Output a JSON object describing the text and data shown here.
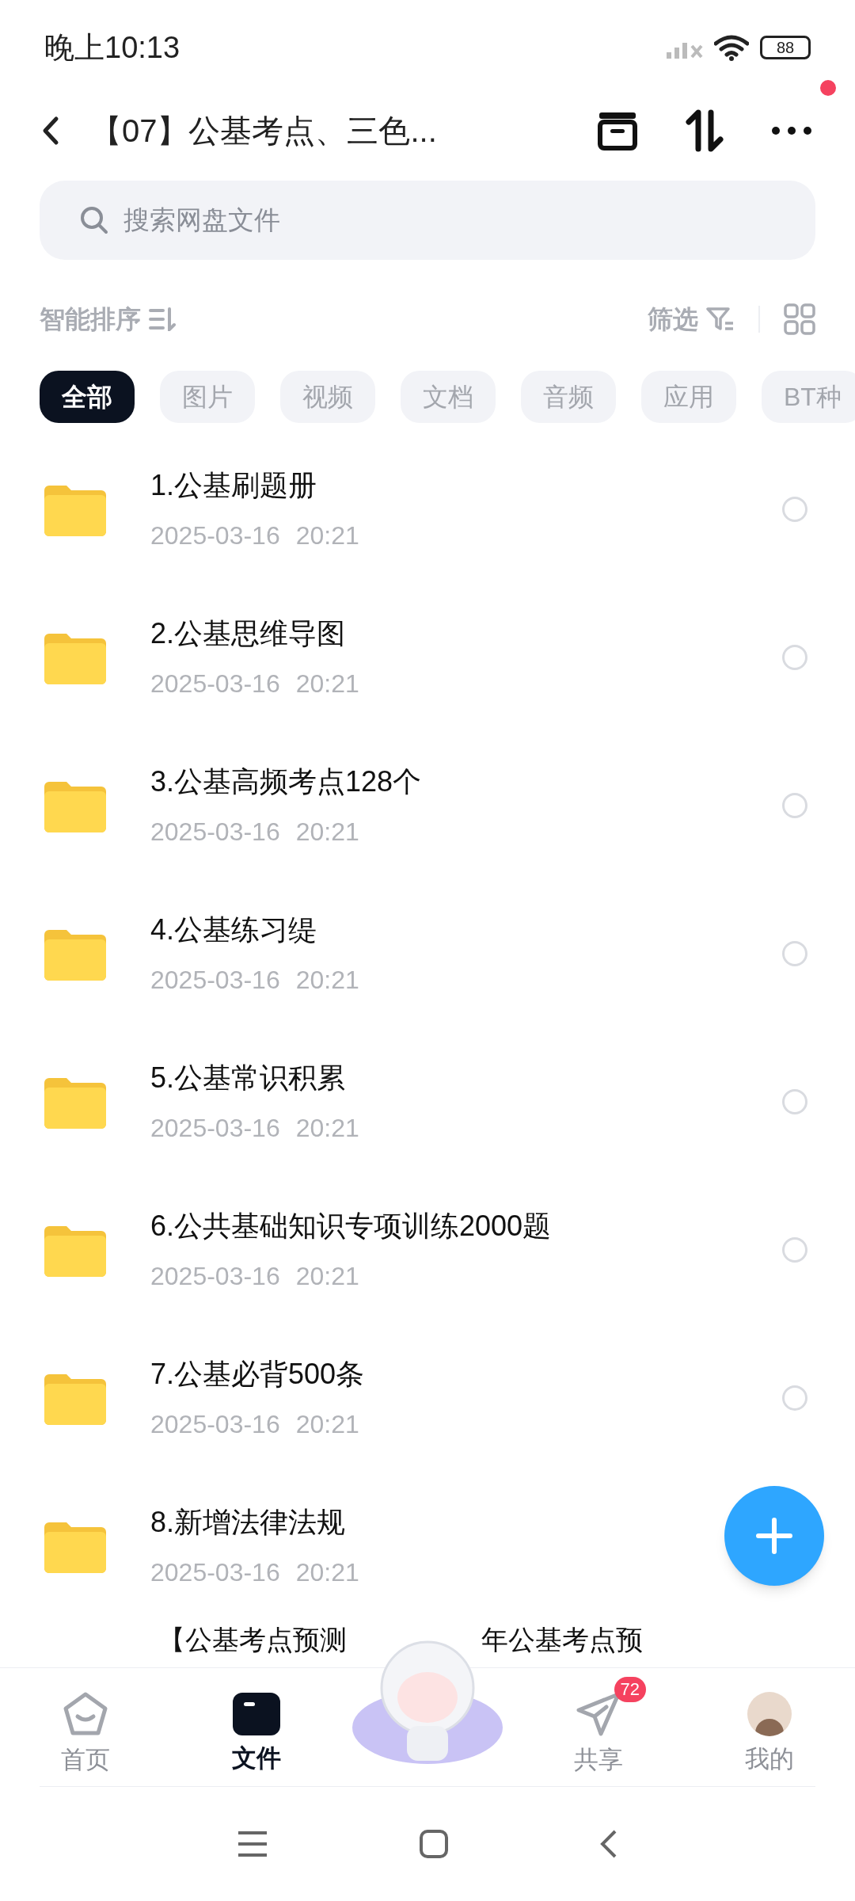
{
  "status_bar": {
    "time": "晚上10:13",
    "battery": "88"
  },
  "header": {
    "title": "【07】公基考点、三色...",
    "notification_dot": true
  },
  "search": {
    "placeholder": "搜索网盘文件"
  },
  "toolbar": {
    "sort": "智能排序",
    "filter": "筛选"
  },
  "chips": [
    {
      "label": "全部",
      "selected": true
    },
    {
      "label": "图片",
      "selected": false
    },
    {
      "label": "视频",
      "selected": false
    },
    {
      "label": "文档",
      "selected": false
    },
    {
      "label": "音频",
      "selected": false
    },
    {
      "label": "应用",
      "selected": false
    },
    {
      "label": "BT种",
      "selected": false
    }
  ],
  "files": [
    {
      "name": "1.公基刷题册",
      "date": "2025-03-16",
      "time": "20:21",
      "checked": false
    },
    {
      "name": "2.公基思维导图",
      "date": "2025-03-16",
      "time": "20:21",
      "checked": false
    },
    {
      "name": "3.公基高频考点128个",
      "date": "2025-03-16",
      "time": "20:21",
      "checked": false
    },
    {
      "name": "4.公基练习缇",
      "date": "2025-03-16",
      "time": "20:21",
      "checked": false
    },
    {
      "name": "5.公基常识积累",
      "date": "2025-03-16",
      "time": "20:21",
      "checked": false
    },
    {
      "name": "6.公共基础知识专项训练2000题",
      "date": "2025-03-16",
      "time": "20:21",
      "checked": false
    },
    {
      "name": "7.公基必背500条",
      "date": "2025-03-16",
      "time": "20:21",
      "checked": false
    },
    {
      "name": "8.新增法律法规",
      "date": "2025-03-16",
      "time": "20:21"
    }
  ],
  "partial_row": {
    "text_left": "【公基考点预测",
    "text_right": "年公基考点预"
  },
  "bottom_nav": [
    {
      "label": "首页",
      "selected": false,
      "kind": "home"
    },
    {
      "label": "文件",
      "selected": true,
      "kind": "files"
    },
    {
      "kind": "mascot",
      "selected": false
    },
    {
      "label": "共享",
      "selected": false,
      "kind": "share",
      "badge": "72"
    },
    {
      "label": "我的",
      "selected": false,
      "kind": "me"
    }
  ]
}
